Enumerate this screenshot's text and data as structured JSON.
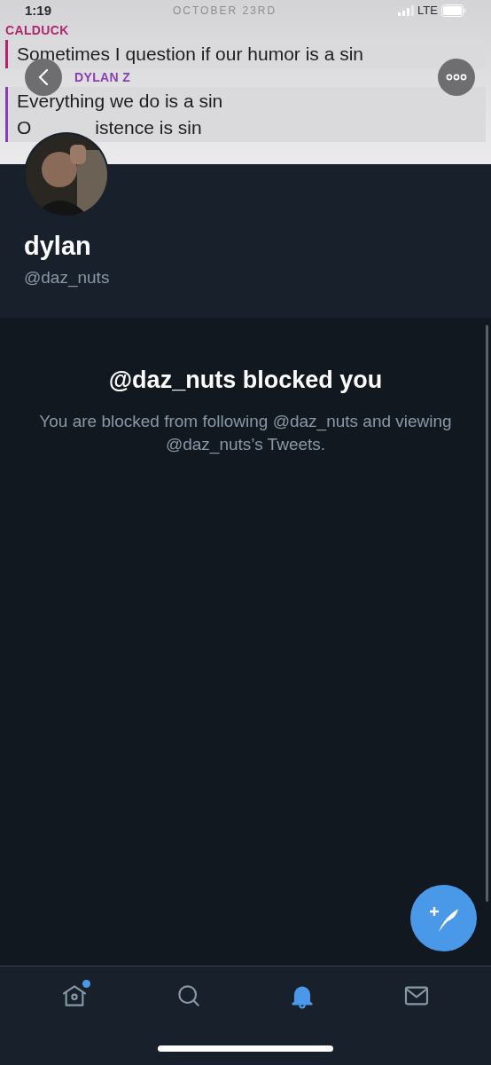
{
  "status_bar": {
    "time": "1:19",
    "network": "LTE"
  },
  "header_chat": {
    "date": "OCTOBER 23RD",
    "messages": [
      {
        "sender": "CALDUCK",
        "color": "#b0256e",
        "lines": [
          [
            "Sometimes I question if our humor is a sin"
          ]
        ]
      },
      {
        "sender": "DYLAN Z",
        "color": "#8a3fae",
        "lines": [
          [
            "Everything we do is a sin"
          ],
          [
            "O",
            "istence is sin"
          ]
        ]
      }
    ]
  },
  "profile": {
    "name": "dylan",
    "handle": "@daz_nuts"
  },
  "blocked": {
    "title": "@daz_nuts blocked you",
    "message": "You are blocked from following @daz_nuts and viewing @daz_nuts’s Tweets."
  },
  "tabs": [
    {
      "kind": "home",
      "selected": false,
      "badge": true
    },
    {
      "kind": "search",
      "selected": false,
      "badge": false
    },
    {
      "kind": "notifications",
      "selected": true,
      "badge": false
    },
    {
      "kind": "messages",
      "selected": false,
      "badge": false
    }
  ]
}
